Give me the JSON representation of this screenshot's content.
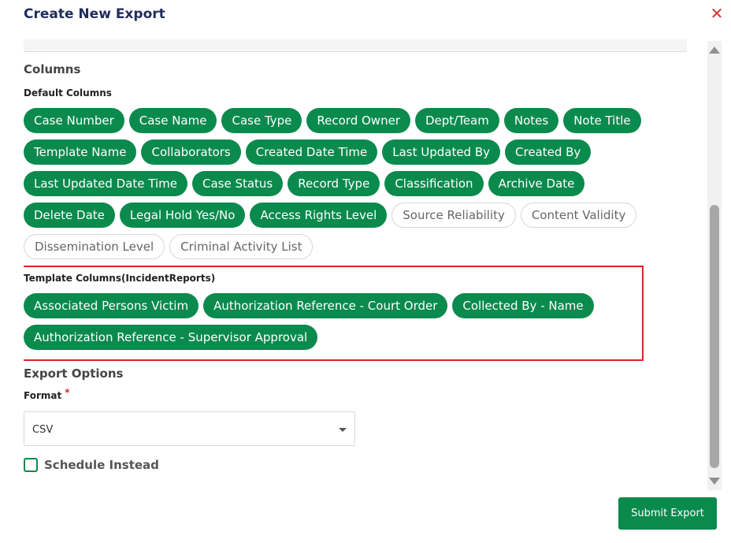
{
  "dialog": {
    "title": "Create New Export",
    "close_icon": "close-icon"
  },
  "columns": {
    "heading": "Columns",
    "default_heading": "Default Columns",
    "default_rows": [
      [
        {
          "label": "Case Number",
          "selected": true
        },
        {
          "label": "Case Name",
          "selected": true
        },
        {
          "label": "Case Type",
          "selected": true
        },
        {
          "label": "Record Owner",
          "selected": true
        },
        {
          "label": "Dept/Team",
          "selected": true
        },
        {
          "label": "Notes",
          "selected": true
        },
        {
          "label": "Note Title",
          "selected": true
        }
      ],
      [
        {
          "label": "Template Name",
          "selected": true
        },
        {
          "label": "Collaborators",
          "selected": true
        },
        {
          "label": "Created Date Time",
          "selected": true
        },
        {
          "label": "Last Updated By",
          "selected": true
        },
        {
          "label": "Created By",
          "selected": true
        }
      ],
      [
        {
          "label": "Last Updated Date Time",
          "selected": true
        },
        {
          "label": "Case Status",
          "selected": true
        },
        {
          "label": "Record Type",
          "selected": true
        },
        {
          "label": "Classification",
          "selected": true
        },
        {
          "label": "Archive Date",
          "selected": true
        }
      ],
      [
        {
          "label": "Delete Date",
          "selected": true
        },
        {
          "label": "Legal Hold Yes/No",
          "selected": true
        },
        {
          "label": "Access Rights Level",
          "selected": true
        },
        {
          "label": "Source Reliability",
          "selected": false
        },
        {
          "label": "Content Validity",
          "selected": false
        }
      ],
      [
        {
          "label": "Dissemination Level",
          "selected": false
        },
        {
          "label": "Criminal Activity List",
          "selected": false
        }
      ]
    ],
    "template_heading": "Template Columns(IncidentReports)",
    "template_rows": [
      [
        {
          "label": "Associated Persons Victim",
          "selected": true
        },
        {
          "label": "Authorization Reference - Court Order",
          "selected": true
        },
        {
          "label": "Collected By - Name",
          "selected": true
        }
      ],
      [
        {
          "label": "Authorization Reference - Supervisor Approval",
          "selected": true
        }
      ]
    ]
  },
  "export_options": {
    "heading": "Export Options",
    "format_label": "Format",
    "required_mark": "*",
    "format_value": "CSV",
    "schedule_label": "Schedule Instead",
    "schedule_checked": false
  },
  "footer": {
    "submit_label": "Submit Export"
  },
  "colors": {
    "accent": "#0b8a4d",
    "highlight_border": "#d8262b",
    "title": "#1f2d5a"
  }
}
